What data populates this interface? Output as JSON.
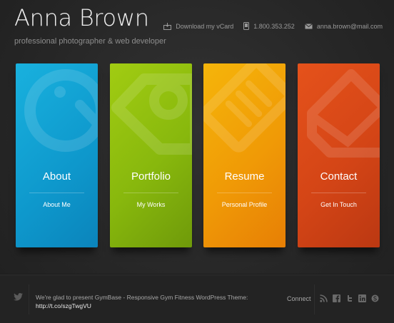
{
  "header": {
    "name": "Anna Brown",
    "tagline": "professional photographer & web developer"
  },
  "contact_bar": {
    "vcard_label": "Download my vCard",
    "phone": "1.800.353.252",
    "email": "anna.brown@mail.com"
  },
  "tiles": [
    {
      "title": "About",
      "subtitle": "About Me",
      "color": "#0e98cc",
      "icon": "camera-icon"
    },
    {
      "title": "Portfolio",
      "subtitle": "My Works",
      "color": "#88b80d",
      "icon": "price-tag-icon"
    },
    {
      "title": "Resume",
      "subtitle": "Personal Profile",
      "color": "#f09a06",
      "icon": "document-icon"
    },
    {
      "title": "Contact",
      "subtitle": "Get In Touch",
      "color": "#d44516",
      "icon": "envelope-icon"
    }
  ],
  "footer": {
    "tweet_text": "We're glad to present GymBase - Responsive Gym Fitness WordPress Theme:",
    "tweet_link": "http://t.co/szgTwgVU",
    "connect_label": "Connect",
    "social_icons": [
      "rss-icon",
      "facebook-icon",
      "twitter-icon",
      "linkedin-icon",
      "skype-icon"
    ]
  }
}
